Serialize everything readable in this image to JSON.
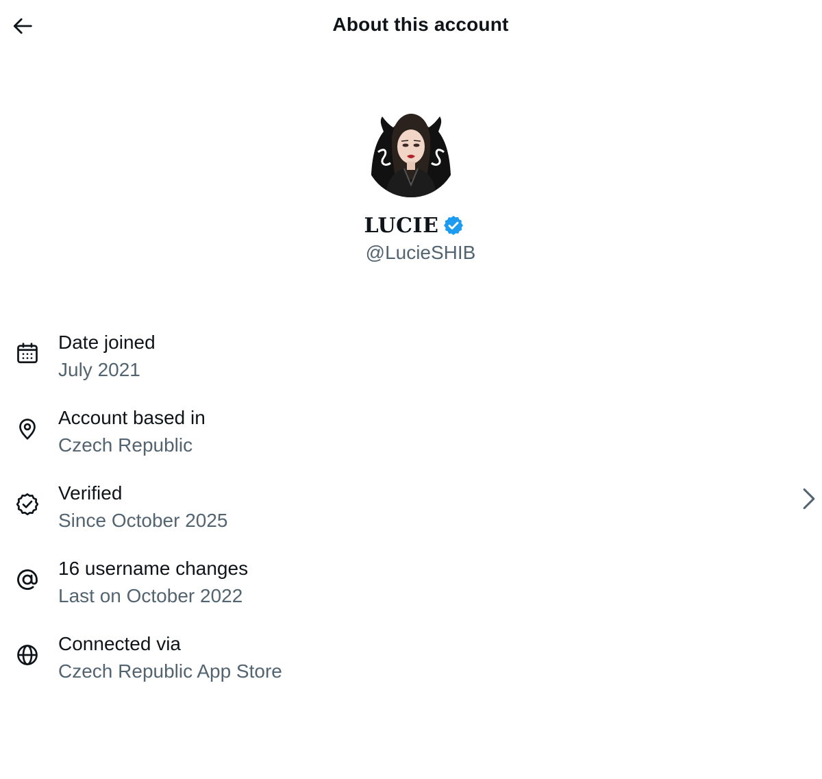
{
  "header": {
    "title": "About this account",
    "back_icon": "arrow-left-icon"
  },
  "profile": {
    "display_name": "LUCIE",
    "handle": "@LucieSHIB",
    "verified": true,
    "badge_color": "#1d9bf0"
  },
  "info": [
    {
      "icon": "calendar-icon",
      "label": "Date joined",
      "value": "July 2021"
    },
    {
      "icon": "location-pin-icon",
      "label": "Account based in",
      "value": "Czech Republic"
    },
    {
      "icon": "verified-badge-outline-icon",
      "label": "Verified",
      "value": "Since October 2025",
      "has_chevron": true
    },
    {
      "icon": "at-sign-icon",
      "label": "16 username changes",
      "value": "Last on October 2022"
    },
    {
      "icon": "globe-icon",
      "label": "Connected via",
      "value": "Czech Republic App Store"
    }
  ],
  "colors": {
    "text_primary": "#0f1419",
    "text_secondary": "#536471",
    "accent": "#1d9bf0"
  }
}
